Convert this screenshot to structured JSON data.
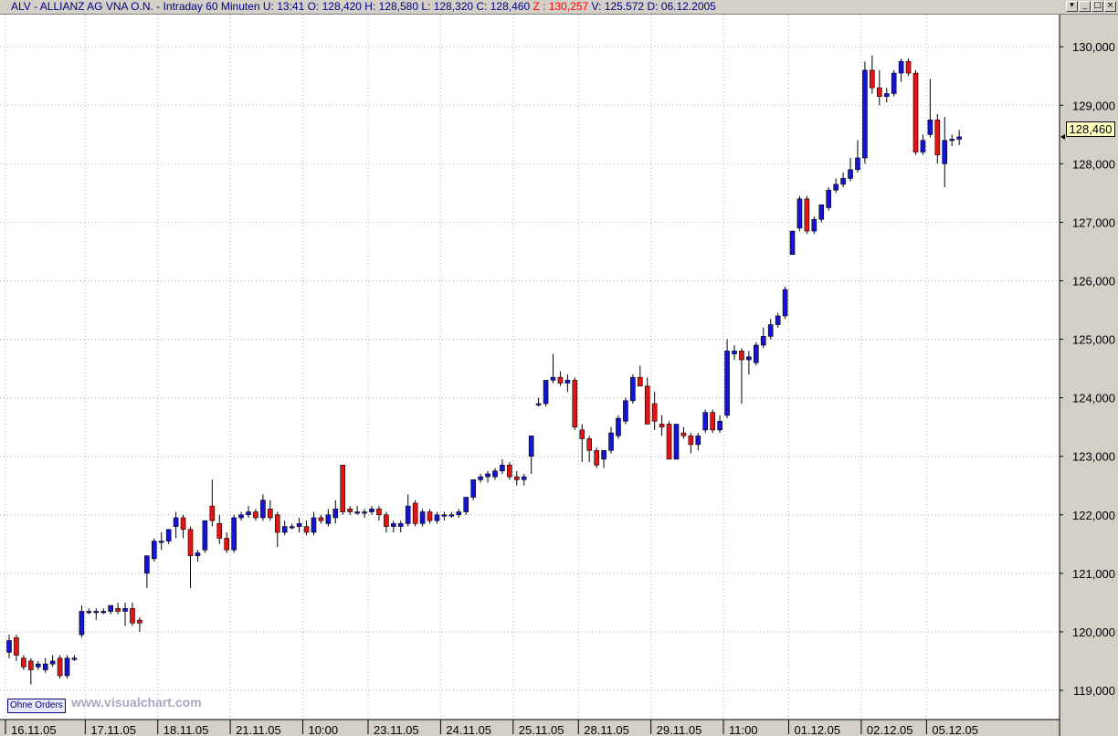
{
  "header": {
    "symbol_line": "ALV - ALLIANZ AG VNA O.N. - Intraday 60 Minuten  U: 13:41  O: 128,420  H: 128,580  L: 128,320  C: 128,460 ",
    "z_text": "Z : 130,257",
    "volume_line": " V: 125.572  D: 06.12.2005",
    "window_buttons": [
      "▾",
      "_",
      "□",
      "×"
    ]
  },
  "badges": {
    "ohne_orders": "Ohne Orders",
    "watermark": "www.visualchart.com"
  },
  "colors": {
    "up": "#1414d2",
    "down": "#e21414",
    "wick": "#000000",
    "grid": "#b0b0b0"
  },
  "chart_data": {
    "type": "candlestick",
    "title": "ALV - ALLIANZ AG VNA O.N. - Intraday 60 Minuten",
    "last_price": "128,460",
    "ylim": [
      118.5,
      130.55
    ],
    "yticks": [
      119,
      120,
      121,
      122,
      123,
      124,
      125,
      126,
      127,
      128,
      129,
      130
    ],
    "ytick_labels": [
      "119,000",
      "120,000",
      "121,000",
      "122,000",
      "123,000",
      "124,000",
      "125,000",
      "126,000",
      "127,000",
      "128,000",
      "129,000",
      "130,000"
    ],
    "xtick_labels": [
      {
        "label": "16.11.05",
        "bar": 0
      },
      {
        "label": "17.11.05",
        "bar": 11
      },
      {
        "label": "18.11.05",
        "bar": 21
      },
      {
        "label": "21.11.05",
        "bar": 31
      },
      {
        "label": "10:00",
        "bar": 41
      },
      {
        "label": "23.11.05",
        "bar": 50
      },
      {
        "label": "24.11.05",
        "bar": 60
      },
      {
        "label": "25.11.05",
        "bar": 70
      },
      {
        "label": "28.11.05",
        "bar": 79
      },
      {
        "label": "29.11.05",
        "bar": 89
      },
      {
        "label": "11:00",
        "bar": 99
      },
      {
        "label": "01.12.05",
        "bar": 108
      },
      {
        "label": "02.12.05",
        "bar": 118
      },
      {
        "label": "05.12.05",
        "bar": 127
      }
    ],
    "grid": true,
    "candles": [
      {
        "o": 119.65,
        "h": 119.95,
        "l": 119.55,
        "c": 119.85
      },
      {
        "o": 119.9,
        "h": 119.95,
        "l": 119.5,
        "c": 119.6
      },
      {
        "o": 119.55,
        "h": 119.6,
        "l": 119.35,
        "c": 119.4
      },
      {
        "o": 119.5,
        "h": 119.55,
        "l": 119.1,
        "c": 119.35
      },
      {
        "o": 119.4,
        "h": 119.5,
        "l": 119.35,
        "c": 119.45
      },
      {
        "o": 119.35,
        "h": 119.55,
        "l": 119.3,
        "c": 119.45
      },
      {
        "o": 119.45,
        "h": 119.6,
        "l": 119.4,
        "c": 119.5
      },
      {
        "o": 119.55,
        "h": 119.6,
        "l": 119.2,
        "c": 119.25
      },
      {
        "o": 119.25,
        "h": 119.6,
        "l": 119.2,
        "c": 119.55
      },
      {
        "o": 119.55,
        "h": 119.6,
        "l": 119.5,
        "c": 119.55
      },
      {
        "o": 119.95,
        "h": 120.45,
        "l": 119.9,
        "c": 120.35
      },
      {
        "o": 120.35,
        "h": 120.4,
        "l": 120.3,
        "c": 120.35
      },
      {
        "o": 120.35,
        "h": 120.4,
        "l": 120.2,
        "c": 120.35
      },
      {
        "o": 120.35,
        "h": 120.4,
        "l": 120.3,
        "c": 120.35
      },
      {
        "o": 120.35,
        "h": 120.45,
        "l": 120.3,
        "c": 120.45
      },
      {
        "o": 120.4,
        "h": 120.5,
        "l": 120.3,
        "c": 120.35
      },
      {
        "o": 120.35,
        "h": 120.5,
        "l": 120.1,
        "c": 120.4
      },
      {
        "o": 120.4,
        "h": 120.5,
        "l": 120.1,
        "c": 120.15
      },
      {
        "o": 120.2,
        "h": 120.25,
        "l": 120.0,
        "c": 120.15
      },
      {
        "o": 121.0,
        "h": 121.3,
        "l": 120.75,
        "c": 121.3
      },
      {
        "o": 121.25,
        "h": 121.6,
        "l": 121.2,
        "c": 121.55
      },
      {
        "o": 121.55,
        "h": 121.7,
        "l": 121.4,
        "c": 121.55
      },
      {
        "o": 121.55,
        "h": 121.75,
        "l": 121.5,
        "c": 121.75
      },
      {
        "o": 121.8,
        "h": 122.05,
        "l": 121.6,
        "c": 121.95
      },
      {
        "o": 121.95,
        "h": 122.0,
        "l": 121.6,
        "c": 121.75
      },
      {
        "o": 121.75,
        "h": 121.8,
        "l": 120.75,
        "c": 121.3
      },
      {
        "o": 121.3,
        "h": 121.4,
        "l": 121.2,
        "c": 121.35
      },
      {
        "o": 121.4,
        "h": 121.9,
        "l": 121.35,
        "c": 121.9
      },
      {
        "o": 122.15,
        "h": 122.6,
        "l": 121.8,
        "c": 121.9
      },
      {
        "o": 121.85,
        "h": 122.0,
        "l": 121.5,
        "c": 121.6
      },
      {
        "o": 121.6,
        "h": 121.7,
        "l": 121.35,
        "c": 121.4
      },
      {
        "o": 121.4,
        "h": 122.0,
        "l": 121.35,
        "c": 121.95
      },
      {
        "o": 121.95,
        "h": 122.05,
        "l": 121.9,
        "c": 122.0
      },
      {
        "o": 122.0,
        "h": 122.15,
        "l": 121.95,
        "c": 122.05
      },
      {
        "o": 122.05,
        "h": 122.1,
        "l": 121.9,
        "c": 121.95
      },
      {
        "o": 121.95,
        "h": 122.35,
        "l": 121.9,
        "c": 122.25
      },
      {
        "o": 122.1,
        "h": 122.25,
        "l": 121.9,
        "c": 121.95
      },
      {
        "o": 122.0,
        "h": 122.05,
        "l": 121.45,
        "c": 121.7
      },
      {
        "o": 121.7,
        "h": 121.9,
        "l": 121.65,
        "c": 121.8
      },
      {
        "o": 121.8,
        "h": 121.85,
        "l": 121.75,
        "c": 121.8
      },
      {
        "o": 121.8,
        "h": 121.95,
        "l": 121.7,
        "c": 121.85
      },
      {
        "o": 121.8,
        "h": 121.9,
        "l": 121.65,
        "c": 121.7
      },
      {
        "o": 121.7,
        "h": 122.05,
        "l": 121.65,
        "c": 121.95
      },
      {
        "o": 121.95,
        "h": 122.0,
        "l": 121.85,
        "c": 121.9
      },
      {
        "o": 121.85,
        "h": 122.1,
        "l": 121.8,
        "c": 122.0
      },
      {
        "o": 121.95,
        "h": 122.25,
        "l": 121.85,
        "c": 122.1
      },
      {
        "o": 122.85,
        "h": 122.85,
        "l": 122.0,
        "c": 122.05
      },
      {
        "o": 122.1,
        "h": 122.15,
        "l": 122.0,
        "c": 122.05
      },
      {
        "o": 122.05,
        "h": 122.15,
        "l": 122.0,
        "c": 122.05
      },
      {
        "o": 122.05,
        "h": 122.1,
        "l": 121.95,
        "c": 122.05
      },
      {
        "o": 122.05,
        "h": 122.15,
        "l": 122.0,
        "c": 122.1
      },
      {
        "o": 122.1,
        "h": 122.15,
        "l": 121.9,
        "c": 122.0
      },
      {
        "o": 122.0,
        "h": 122.05,
        "l": 121.7,
        "c": 121.8
      },
      {
        "o": 121.8,
        "h": 121.9,
        "l": 121.7,
        "c": 121.85
      },
      {
        "o": 121.8,
        "h": 121.9,
        "l": 121.7,
        "c": 121.85
      },
      {
        "o": 121.85,
        "h": 122.35,
        "l": 121.8,
        "c": 122.15
      },
      {
        "o": 122.2,
        "h": 122.25,
        "l": 121.8,
        "c": 121.85
      },
      {
        "o": 121.85,
        "h": 122.1,
        "l": 121.8,
        "c": 122.05
      },
      {
        "o": 122.05,
        "h": 122.1,
        "l": 121.85,
        "c": 121.9
      },
      {
        "o": 121.9,
        "h": 122.05,
        "l": 121.85,
        "c": 122.0
      },
      {
        "o": 122.0,
        "h": 122.05,
        "l": 121.9,
        "c": 122.0
      },
      {
        "o": 122.0,
        "h": 122.05,
        "l": 121.95,
        "c": 122.0
      },
      {
        "o": 122.0,
        "h": 122.1,
        "l": 121.95,
        "c": 122.05
      },
      {
        "o": 122.05,
        "h": 122.3,
        "l": 122.0,
        "c": 122.3
      },
      {
        "o": 122.3,
        "h": 122.6,
        "l": 122.25,
        "c": 122.6
      },
      {
        "o": 122.6,
        "h": 122.7,
        "l": 122.55,
        "c": 122.65
      },
      {
        "o": 122.65,
        "h": 122.75,
        "l": 122.55,
        "c": 122.7
      },
      {
        "o": 122.65,
        "h": 122.8,
        "l": 122.6,
        "c": 122.75
      },
      {
        "o": 122.75,
        "h": 122.95,
        "l": 122.7,
        "c": 122.85
      },
      {
        "o": 122.85,
        "h": 122.9,
        "l": 122.6,
        "c": 122.65
      },
      {
        "o": 122.65,
        "h": 122.75,
        "l": 122.5,
        "c": 122.6
      },
      {
        "o": 122.6,
        "h": 122.7,
        "l": 122.5,
        "c": 122.65
      },
      {
        "o": 123.0,
        "h": 123.35,
        "l": 122.7,
        "c": 123.35
      },
      {
        "o": 123.9,
        "h": 124.0,
        "l": 123.85,
        "c": 123.9
      },
      {
        "o": 123.9,
        "h": 124.3,
        "l": 123.85,
        "c": 124.3
      },
      {
        "o": 124.3,
        "h": 124.75,
        "l": 124.25,
        "c": 124.35
      },
      {
        "o": 124.35,
        "h": 124.45,
        "l": 124.2,
        "c": 124.25
      },
      {
        "o": 124.25,
        "h": 124.4,
        "l": 124.1,
        "c": 124.3
      },
      {
        "o": 124.3,
        "h": 124.35,
        "l": 123.45,
        "c": 123.5
      },
      {
        "o": 123.45,
        "h": 123.55,
        "l": 122.9,
        "c": 123.3
      },
      {
        "o": 123.3,
        "h": 123.35,
        "l": 122.9,
        "c": 123.1
      },
      {
        "o": 123.1,
        "h": 123.15,
        "l": 122.8,
        "c": 122.85
      },
      {
        "o": 122.95,
        "h": 123.1,
        "l": 122.8,
        "c": 123.1
      },
      {
        "o": 123.1,
        "h": 123.5,
        "l": 123.05,
        "c": 123.4
      },
      {
        "o": 123.35,
        "h": 123.7,
        "l": 123.3,
        "c": 123.65
      },
      {
        "o": 123.6,
        "h": 124.0,
        "l": 123.55,
        "c": 123.95
      },
      {
        "o": 123.95,
        "h": 124.4,
        "l": 123.9,
        "c": 124.35
      },
      {
        "o": 124.35,
        "h": 124.55,
        "l": 124.25,
        "c": 124.2
      },
      {
        "o": 124.2,
        "h": 124.35,
        "l": 123.55,
        "c": 123.55
      },
      {
        "o": 123.9,
        "h": 124.1,
        "l": 123.45,
        "c": 123.6
      },
      {
        "o": 123.55,
        "h": 123.7,
        "l": 123.35,
        "c": 123.5
      },
      {
        "o": 123.55,
        "h": 123.6,
        "l": 122.95,
        "c": 122.95
      },
      {
        "o": 122.95,
        "h": 123.55,
        "l": 122.95,
        "c": 123.55
      },
      {
        "o": 123.4,
        "h": 123.5,
        "l": 123.3,
        "c": 123.35
      },
      {
        "o": 123.35,
        "h": 123.4,
        "l": 123.05,
        "c": 123.2
      },
      {
        "o": 123.2,
        "h": 123.4,
        "l": 123.1,
        "c": 123.35
      },
      {
        "o": 123.45,
        "h": 123.8,
        "l": 123.4,
        "c": 123.75
      },
      {
        "o": 123.75,
        "h": 123.8,
        "l": 123.4,
        "c": 123.45
      },
      {
        "o": 123.45,
        "h": 123.7,
        "l": 123.4,
        "c": 123.6
      },
      {
        "o": 123.7,
        "h": 125.0,
        "l": 123.65,
        "c": 124.8
      },
      {
        "o": 124.75,
        "h": 124.9,
        "l": 124.65,
        "c": 124.8
      },
      {
        "o": 124.8,
        "h": 124.85,
        "l": 123.9,
        "c": 124.65
      },
      {
        "o": 124.65,
        "h": 124.8,
        "l": 124.4,
        "c": 124.7
      },
      {
        "o": 124.6,
        "h": 124.95,
        "l": 124.55,
        "c": 124.9
      },
      {
        "o": 124.9,
        "h": 125.2,
        "l": 124.85,
        "c": 125.05
      },
      {
        "o": 125.05,
        "h": 125.35,
        "l": 125.0,
        "c": 125.25
      },
      {
        "o": 125.25,
        "h": 125.45,
        "l": 125.2,
        "c": 125.4
      },
      {
        "o": 125.4,
        "h": 125.9,
        "l": 125.35,
        "c": 125.85
      },
      {
        "o": 126.45,
        "h": 126.85,
        "l": 126.45,
        "c": 126.85
      },
      {
        "o": 126.9,
        "h": 127.45,
        "l": 126.85,
        "c": 127.4
      },
      {
        "o": 127.4,
        "h": 127.45,
        "l": 126.8,
        "c": 126.85
      },
      {
        "o": 126.85,
        "h": 127.1,
        "l": 126.8,
        "c": 127.05
      },
      {
        "o": 127.05,
        "h": 127.3,
        "l": 127.0,
        "c": 127.3
      },
      {
        "o": 127.25,
        "h": 127.6,
        "l": 127.2,
        "c": 127.55
      },
      {
        "o": 127.55,
        "h": 127.75,
        "l": 127.5,
        "c": 127.65
      },
      {
        "o": 127.65,
        "h": 127.85,
        "l": 127.6,
        "c": 127.75
      },
      {
        "o": 127.75,
        "h": 128.1,
        "l": 127.7,
        "c": 127.9
      },
      {
        "o": 127.9,
        "h": 128.4,
        "l": 127.85,
        "c": 128.1
      },
      {
        "o": 128.1,
        "h": 129.75,
        "l": 128.0,
        "c": 129.6
      },
      {
        "o": 129.6,
        "h": 129.85,
        "l": 129.2,
        "c": 129.3
      },
      {
        "o": 129.3,
        "h": 129.6,
        "l": 129.0,
        "c": 129.15
      },
      {
        "o": 129.15,
        "h": 129.3,
        "l": 129.05,
        "c": 129.2
      },
      {
        "o": 129.2,
        "h": 129.6,
        "l": 129.15,
        "c": 129.55
      },
      {
        "o": 129.55,
        "h": 129.8,
        "l": 129.4,
        "c": 129.75
      },
      {
        "o": 129.75,
        "h": 129.8,
        "l": 129.5,
        "c": 129.55
      },
      {
        "o": 129.55,
        "h": 129.6,
        "l": 128.15,
        "c": 128.2
      },
      {
        "o": 128.2,
        "h": 128.5,
        "l": 128.15,
        "c": 128.4
      },
      {
        "o": 128.5,
        "h": 129.45,
        "l": 128.45,
        "c": 128.75
      },
      {
        "o": 128.75,
        "h": 128.85,
        "l": 128.0,
        "c": 128.15
      },
      {
        "o": 128.0,
        "h": 128.8,
        "l": 127.6,
        "c": 128.4
      },
      {
        "o": 128.4,
        "h": 128.5,
        "l": 128.3,
        "c": 128.42
      },
      {
        "o": 128.42,
        "h": 128.58,
        "l": 128.32,
        "c": 128.46
      }
    ]
  }
}
